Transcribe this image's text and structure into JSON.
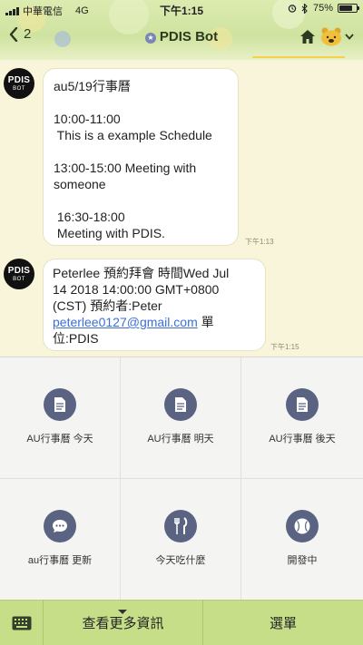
{
  "status_bar": {
    "carrier": "中華電信",
    "network": "4G",
    "time": "下午1:15",
    "battery": "75%",
    "battery_level": 0.75
  },
  "header": {
    "back_count": "2",
    "title": "PDIS Bot",
    "icons": [
      "chevron-left-icon",
      "verified-badge-icon",
      "home-icon",
      "bear-icon",
      "chevron-down-icon"
    ]
  },
  "messages": [
    {
      "avatar": {
        "line1": "PDIS",
        "line2": "BOT"
      },
      "lines": [
        "au5/19行事曆",
        "",
        "10:00-11:00",
        " This is a example Schedule",
        "",
        "13:00-15:00 Meeting with",
        "someone",
        "",
        " 16:30-18:00",
        " Meeting with PDIS."
      ],
      "time": "下午1:13"
    },
    {
      "avatar": {
        "line1": "PDIS",
        "line2": "BOT"
      },
      "line1": "Peterlee 預約拜會 時間Wed Jul",
      "line2": "14 2018 14:00:00 GMT+0800",
      "line3_prefix": "(CST) 預約者:Peter",
      "email": "peterlee0127@gmail.com",
      "line4_suffix": " 單",
      "line5": "位:PDIS",
      "time": "下午1:15"
    }
  ],
  "menu": {
    "items": [
      {
        "label": "AU行事曆 今天",
        "icon": "document-icon"
      },
      {
        "label": "AU行事曆 明天",
        "icon": "document-icon"
      },
      {
        "label": "AU行事曆 後天",
        "icon": "document-icon"
      },
      {
        "label": "au行事曆 更新",
        "icon": "chat-bubble-icon"
      },
      {
        "label": "今天吃什麼",
        "icon": "fork-knife-icon"
      },
      {
        "label": "開發中",
        "icon": "baseball-icon"
      }
    ]
  },
  "bottom_bar": {
    "more_label": "查看更多資訊",
    "menu_label": "選單",
    "colors": {
      "bar": "#c6de88",
      "icon_circle": "#5b6382"
    }
  }
}
